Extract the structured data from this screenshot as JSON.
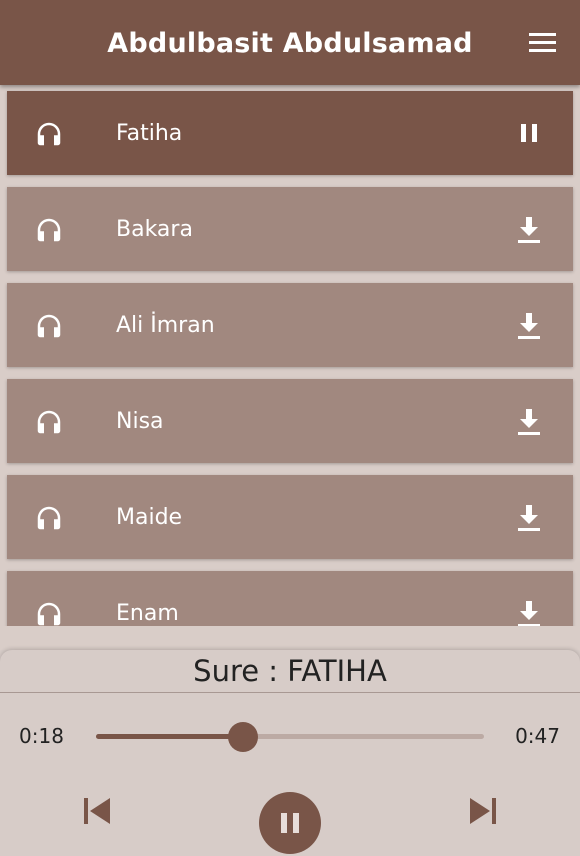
{
  "app_bar": {
    "title": "Abdulbasit Abdulsamad",
    "menu_icon": "menu-icon"
  },
  "surahs": [
    {
      "name": "Fatiha",
      "status": "playing",
      "action_icon": "pause-icon"
    },
    {
      "name": "Bakara",
      "status": "not-downloaded",
      "action_icon": "download-icon"
    },
    {
      "name": "Ali İmran",
      "status": "not-downloaded",
      "action_icon": "download-icon"
    },
    {
      "name": "Nisa",
      "status": "not-downloaded",
      "action_icon": "download-icon"
    },
    {
      "name": "Maide",
      "status": "not-downloaded",
      "action_icon": "download-icon"
    },
    {
      "name": "Enam",
      "status": "not-downloaded",
      "action_icon": "download-icon"
    }
  ],
  "player": {
    "now_playing": "Sure : FATIHA",
    "current_time": "0:18",
    "duration": "0:47",
    "progress": 0.38,
    "state": "playing"
  },
  "colors": {
    "primary": "#795548",
    "item_background": "#a1887f",
    "page_background": "#d9cdc8",
    "track_inactive": "#bcaaa4"
  }
}
